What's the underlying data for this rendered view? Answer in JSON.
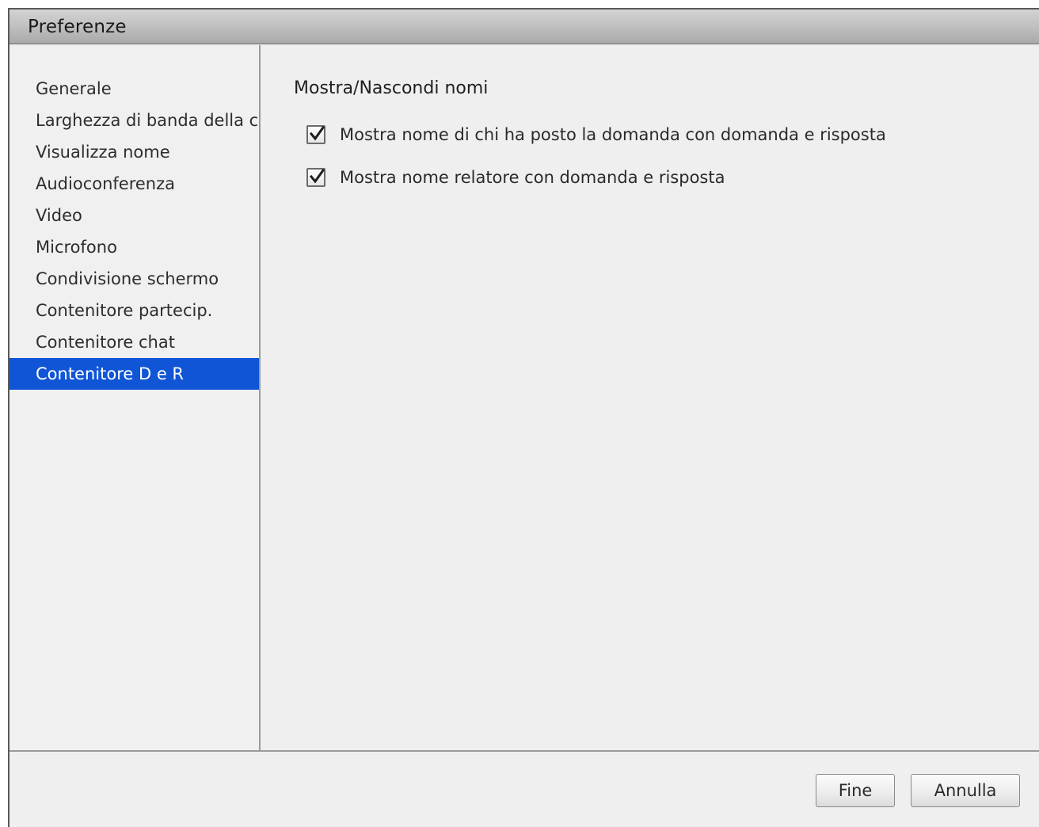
{
  "window": {
    "title": "Preferenze"
  },
  "sidebar": {
    "items": [
      {
        "label": "Generale",
        "selected": false
      },
      {
        "label": "Larghezza di banda della connessione",
        "selected": false
      },
      {
        "label": "Visualizza nome",
        "selected": false
      },
      {
        "label": "Audioconferenza",
        "selected": false
      },
      {
        "label": "Video",
        "selected": false
      },
      {
        "label": "Microfono",
        "selected": false
      },
      {
        "label": "Condivisione schermo",
        "selected": false
      },
      {
        "label": "Contenitore partecip.",
        "selected": false
      },
      {
        "label": "Contenitore chat",
        "selected": false
      },
      {
        "label": "Contenitore D e R",
        "selected": true
      }
    ]
  },
  "content": {
    "heading": "Mostra/Nascondi nomi",
    "options": [
      {
        "label": "Mostra nome di chi ha posto la domanda con domanda e risposta",
        "checked": true
      },
      {
        "label": "Mostra nome relatore con domanda e risposta",
        "checked": true
      }
    ]
  },
  "footer": {
    "ok_label": "Fine",
    "cancel_label": "Annulla"
  },
  "colors": {
    "selection": "#0f55d6",
    "background": "#efefef"
  }
}
